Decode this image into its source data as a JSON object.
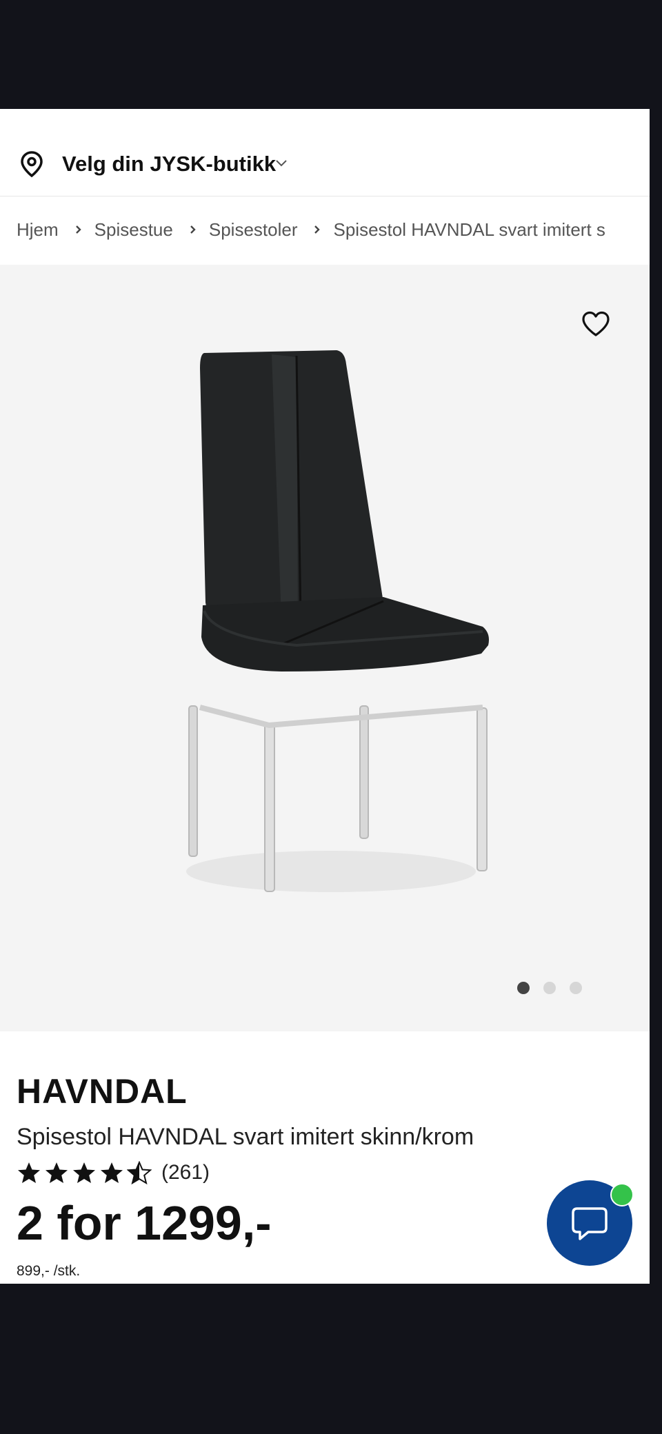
{
  "store": {
    "label": "Velg din JYSK-butikk"
  },
  "breadcrumb": [
    "Hjem",
    "Spisestue",
    "Spisestoler",
    "Spisestol HAVNDAL svart imitert s"
  ],
  "gallery": {
    "image_count": 3,
    "active_index": 0
  },
  "product": {
    "brand": "HAVNDAL",
    "name": "Spisestol HAVNDAL svart imitert skinn/krom",
    "rating": 4.5,
    "rating_max": 5,
    "review_count": "(261)",
    "price": "2 for 1299,-",
    "unit_price": "899,- /stk."
  },
  "colors": {
    "chat_button": "#0d4593",
    "chat_status": "#34c24a",
    "gallery_bg": "#f4f4f4"
  },
  "icons": {
    "store": "location-pin-icon",
    "favorite": "heart-icon",
    "chat": "chat-bubble-icon",
    "breadcrumb_separator": "chevron-right-icon"
  }
}
